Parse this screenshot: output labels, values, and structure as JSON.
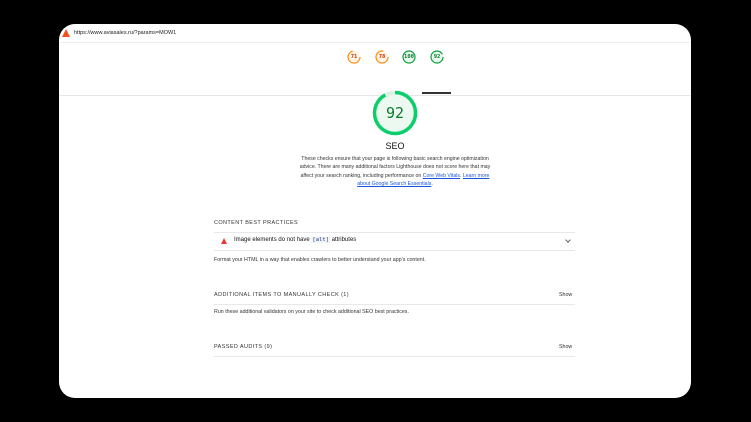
{
  "url": "https://www.aviasales.ru/?params=MOW1",
  "tabs": [
    {
      "score": "71",
      "color": "#fa8c16"
    },
    {
      "score": "78",
      "color": "#fa8c16"
    },
    {
      "score": "100",
      "color": "#0c9d3c"
    },
    {
      "score": "92",
      "color": "#0c9d3c"
    }
  ],
  "category": {
    "score": "92",
    "title": "SEO",
    "description_pre": "These checks ensure that your page is following basic search engine optimization advice. There are many additional factors Lighthouse does not score here that may affect your search ranking, including performance on ",
    "link1": "Core Web Vitals",
    "sep": ". ",
    "link2": "Learn more about Google Search Essentials",
    "description_post": "."
  },
  "sections": {
    "content_best_practices": "CONTENT BEST PRACTICES",
    "audit_pre": "Image elements do not have ",
    "audit_code": "[alt]",
    "audit_post": " attributes",
    "content_desc": "Format your HTML in a way that enables crawlers to better understand your app’s content.",
    "manual_title": "ADDITIONAL ITEMS TO MANUALLY CHECK (1)",
    "manual_desc": "Run these additional validators on your site to check additional SEO best practices.",
    "passed_title": "PASSED AUDITS (9)",
    "show": "Show"
  }
}
